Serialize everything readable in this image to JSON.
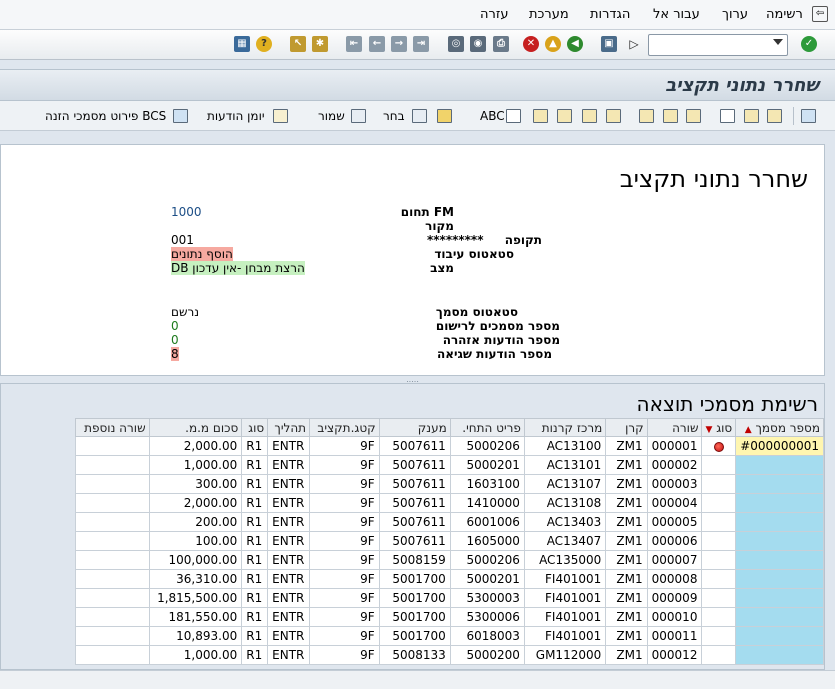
{
  "menu": {
    "items": [
      "רשימה",
      "ערוך",
      "עבור אל",
      "הגדרות",
      "מערכת",
      "עזרה"
    ]
  },
  "window_title": "שחרר נתוני תקציב",
  "app_toolbar": {
    "abc_label": "ABC",
    "choose_label": "בחר",
    "save_label": "שמור",
    "message_log_label": "יומן הודעות",
    "bcs_details_label": "פירוט מסמכי הזנה BCS"
  },
  "header": {
    "heading": "שחרר נתוני תקציב",
    "fields": [
      {
        "label": "תחום FM",
        "value": "1000"
      },
      {
        "label": "מקור",
        "value": ""
      },
      {
        "label": "תקופה",
        "stars": "*********",
        "value": "001"
      },
      {
        "label": "סטאטוס עיבוד",
        "value": "הוסף נתונים"
      },
      {
        "label": "מצב",
        "value": "הרצת מבחן -אין עדכון DB"
      }
    ],
    "doc_fields": [
      {
        "label": "סטאטוס מסמך",
        "value": "נרשם"
      },
      {
        "label": "מספר מסמכים לרישום",
        "value": "0"
      },
      {
        "label": "מספר הודעות אזהרה",
        "value": "0"
      },
      {
        "label": "מספר הודעות שגיאה",
        "value": "8"
      }
    ]
  },
  "results": {
    "heading": "רשימת מסמכי תוצאה",
    "columns": [
      "מספר מסמך",
      "סוג",
      "שורה",
      "קרן",
      "מרכז קרנות",
      "פריט התחי.",
      "מענק",
      "קטג.תקציב",
      "תהליך",
      "סוג",
      "סכום מ.מ.",
      "שורה נוספת"
    ],
    "rows": [
      {
        "doc": "#000000001",
        "status": "error",
        "line": "000001",
        "fund": "ZM1",
        "fc": "AC13100",
        "ci": "5000206",
        "grant": "5007611",
        "cat": "9F",
        "proc": "ENTR",
        "type": "R1",
        "amount": "2,000.00",
        "extra": ""
      },
      {
        "doc": "",
        "status": "",
        "line": "000002",
        "fund": "ZM1",
        "fc": "AC13101",
        "ci": "5000201",
        "grant": "5007611",
        "cat": "9F",
        "proc": "ENTR",
        "type": "R1",
        "amount": "1,000.00",
        "extra": ""
      },
      {
        "doc": "",
        "status": "",
        "line": "000003",
        "fund": "ZM1",
        "fc": "AC13107",
        "ci": "1603100",
        "grant": "5007611",
        "cat": "9F",
        "proc": "ENTR",
        "type": "R1",
        "amount": "300.00",
        "extra": ""
      },
      {
        "doc": "",
        "status": "",
        "line": "000004",
        "fund": "ZM1",
        "fc": "AC13108",
        "ci": "1410000",
        "grant": "5007611",
        "cat": "9F",
        "proc": "ENTR",
        "type": "R1",
        "amount": "2,000.00",
        "extra": ""
      },
      {
        "doc": "",
        "status": "",
        "line": "000005",
        "fund": "ZM1",
        "fc": "AC13403",
        "ci": "6001006",
        "grant": "5007611",
        "cat": "9F",
        "proc": "ENTR",
        "type": "R1",
        "amount": "200.00",
        "extra": ""
      },
      {
        "doc": "",
        "status": "",
        "line": "000006",
        "fund": "ZM1",
        "fc": "AC13407",
        "ci": "1605000",
        "grant": "5007611",
        "cat": "9F",
        "proc": "ENTR",
        "type": "R1",
        "amount": "100.00",
        "extra": ""
      },
      {
        "doc": "",
        "status": "",
        "line": "000007",
        "fund": "ZM1",
        "fc": "AC135000",
        "ci": "5000206",
        "grant": "5008159",
        "cat": "9F",
        "proc": "ENTR",
        "type": "R1",
        "amount": "100,000.00",
        "extra": ""
      },
      {
        "doc": "",
        "status": "",
        "line": "000008",
        "fund": "ZM1",
        "fc": "FI401001",
        "ci": "5000201",
        "grant": "5001700",
        "cat": "9F",
        "proc": "ENTR",
        "type": "R1",
        "amount": "36,310.00",
        "extra": ""
      },
      {
        "doc": "",
        "status": "",
        "line": "000009",
        "fund": "ZM1",
        "fc": "FI401001",
        "ci": "5300003",
        "grant": "5001700",
        "cat": "9F",
        "proc": "ENTR",
        "type": "R1",
        "amount": "1,815,500.00",
        "extra": ""
      },
      {
        "doc": "",
        "status": "",
        "line": "000010",
        "fund": "ZM1",
        "fc": "FI401001",
        "ci": "5300006",
        "grant": "5001700",
        "cat": "9F",
        "proc": "ENTR",
        "type": "R1",
        "amount": "181,550.00",
        "extra": ""
      },
      {
        "doc": "",
        "status": "",
        "line": "000011",
        "fund": "ZM1",
        "fc": "FI401001",
        "ci": "6018003",
        "grant": "5001700",
        "cat": "9F",
        "proc": "ENTR",
        "type": "R1",
        "amount": "10,893.00",
        "extra": ""
      },
      {
        "doc": "",
        "status": "",
        "line": "000012",
        "fund": "ZM1",
        "fc": "GM112000",
        "ci": "5000200",
        "grant": "5008133",
        "cat": "9F",
        "proc": "ENTR",
        "type": "R1",
        "amount": "1,000.00",
        "extra": ""
      }
    ]
  }
}
